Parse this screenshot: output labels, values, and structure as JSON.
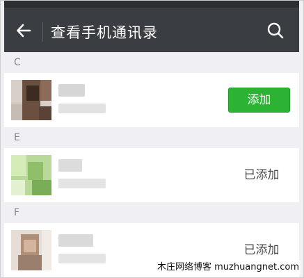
{
  "header": {
    "title": "查看手机通讯录",
    "back_icon": "arrow-left-icon",
    "search_icon": "search-icon",
    "bar_color": "#3a3d42"
  },
  "sections": [
    {
      "letter": "C",
      "contacts": [
        {
          "action_type": "button",
          "action_label": "添加"
        }
      ]
    },
    {
      "letter": "E",
      "contacts": [
        {
          "action_type": "status",
          "action_label": "已添加"
        }
      ]
    },
    {
      "letter": "F",
      "contacts": [
        {
          "action_type": "status",
          "action_label": "已添加"
        }
      ]
    }
  ],
  "colors": {
    "add_button": "#2db334",
    "section_bg": "#efeff4"
  },
  "watermark": "木庄网络博客 muzhuangnet.com"
}
